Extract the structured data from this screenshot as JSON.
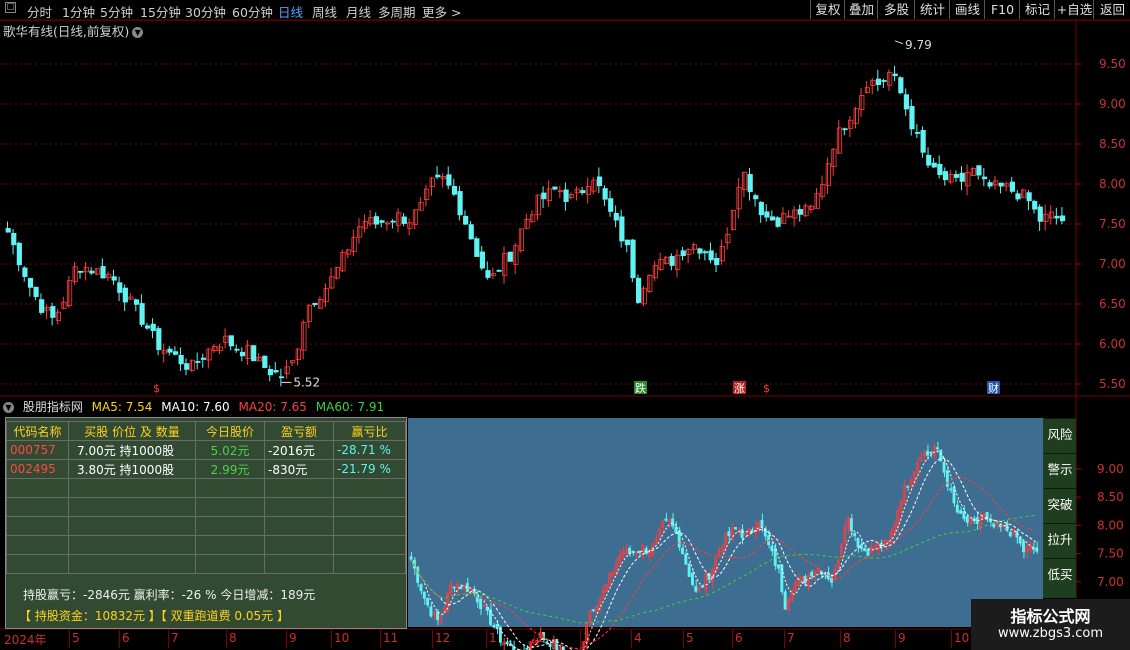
{
  "periods": [
    "分时",
    "1分钟",
    "5分钟",
    "15分钟",
    "30分钟",
    "60分钟",
    "日线",
    "周线",
    "月线",
    "多周期",
    "更多 >"
  ],
  "active_period": "日线",
  "tools": [
    "复权",
    "叠加",
    "多股",
    "统计",
    "画线",
    "F10",
    "标记",
    "+自选",
    "返回"
  ],
  "chart_title": "歌华有线(日线,前复权)",
  "y_axis": [
    "9.50",
    "9.00",
    "8.50",
    "8.00",
    "7.50",
    "7.00",
    "6.50",
    "6.00",
    "5.50"
  ],
  "price_high": "9.79",
  "price_low": "5.52",
  "events": [
    "$",
    "跌",
    "涨",
    "$",
    "财"
  ],
  "indicator": {
    "name": "股朋指标网",
    "ma5": "MA5: 7.54",
    "ma10": "MA10: 7.60",
    "ma20": "MA20: 7.65",
    "ma60": "MA60: 7.91"
  },
  "positions": {
    "headers": [
      "代码名称",
      "买股 价位 及 数量",
      "今日股价",
      "盈亏额",
      "赢亏比"
    ],
    "rows": [
      {
        "code": "000757",
        "buy": "7.00元  持1000股",
        "price": "5.02元",
        "pnl": "-2016元",
        "ratio": "-28.71 %"
      },
      {
        "code": "002495",
        "buy": "3.80元  持1000股",
        "price": "2.99元",
        "pnl": "-830元",
        "ratio": "-21.79 %"
      }
    ],
    "summary1": "持股赢亏：-2846元      赢利率：-26 %      今日增减：189元",
    "summary2": "【  持股资金：10832元  】【  双重跑道费  0.05元  】"
  },
  "side_buttons": [
    "风险",
    "警示",
    "突破",
    "拉升",
    "低买"
  ],
  "lower_y_axis": [
    "9.00",
    "8.50",
    "8.00",
    "7.50",
    "7.00",
    "6.50",
    "6.00"
  ],
  "dates": [
    "2024年",
    "5",
    "6",
    "7",
    "8",
    "9",
    "10",
    "11",
    "12",
    "1",
    "2",
    "3",
    "4",
    "5",
    "6",
    "7",
    "8",
    "9",
    "10"
  ],
  "logo": {
    "title": "指标公式网",
    "url": "www.zbgs3.com"
  },
  "colors": {
    "up": "#ff3c3c",
    "down": "#5ff3f3",
    "grid": "#7a0000",
    "panel_bg": "#314a31",
    "lower_bg": "#3d6e92"
  },
  "chart_data": [
    {
      "type": "candlestick",
      "title": "歌华有线(日线,前复权)",
      "ylim": [
        5.4,
        9.8
      ],
      "y_ticks": [
        5.5,
        6.0,
        6.5,
        7.0,
        7.5,
        8.0,
        8.5,
        9.0,
        9.5
      ],
      "annotations": [
        {
          "label": "9.79",
          "value": 9.79
        },
        {
          "label": "5.52",
          "value": 5.52
        }
      ],
      "close_path": [
        7.4,
        7.05,
        6.7,
        6.45,
        6.3,
        6.6,
        7.0,
        6.95,
        6.9,
        6.85,
        6.65,
        6.45,
        6.25,
        6.0,
        5.9,
        5.8,
        5.7,
        5.85,
        6.0,
        6.05,
        5.95,
        5.9,
        5.75,
        5.65,
        5.6,
        5.8,
        6.45,
        6.6,
        6.75,
        7.0,
        7.3,
        7.55,
        7.5,
        7.55,
        7.6,
        7.55,
        7.7,
        8.0,
        8.05,
        7.85,
        7.5,
        7.1,
        6.75,
        7.0,
        7.15,
        7.5,
        7.75,
        7.85,
        7.95,
        7.8,
        7.9,
        8.15,
        7.8,
        7.5,
        7.2,
        6.6,
        6.95,
        7.0,
        7.05,
        7.2,
        7.25,
        7.15,
        7.0,
        7.55,
        8.2,
        7.9,
        7.6,
        7.55,
        7.6,
        7.65,
        7.65,
        8.0,
        8.5,
        8.75,
        9.0,
        9.3,
        9.25,
        9.4,
        9.1,
        8.7,
        8.3,
        8.1,
        8.05,
        8.0,
        8.2,
        8.0,
        7.95,
        7.95,
        7.9,
        7.8,
        7.55,
        7.6,
        7.55
      ]
    },
    {
      "type": "candlestick",
      "name": "股朋指标网",
      "series": [
        "MA5",
        "MA10",
        "MA20",
        "MA60"
      ],
      "values": [
        7.54,
        7.6,
        7.65,
        7.91
      ],
      "y_ticks": [
        6.0,
        6.5,
        7.0,
        7.5,
        8.0,
        8.5,
        9.0
      ]
    }
  ]
}
